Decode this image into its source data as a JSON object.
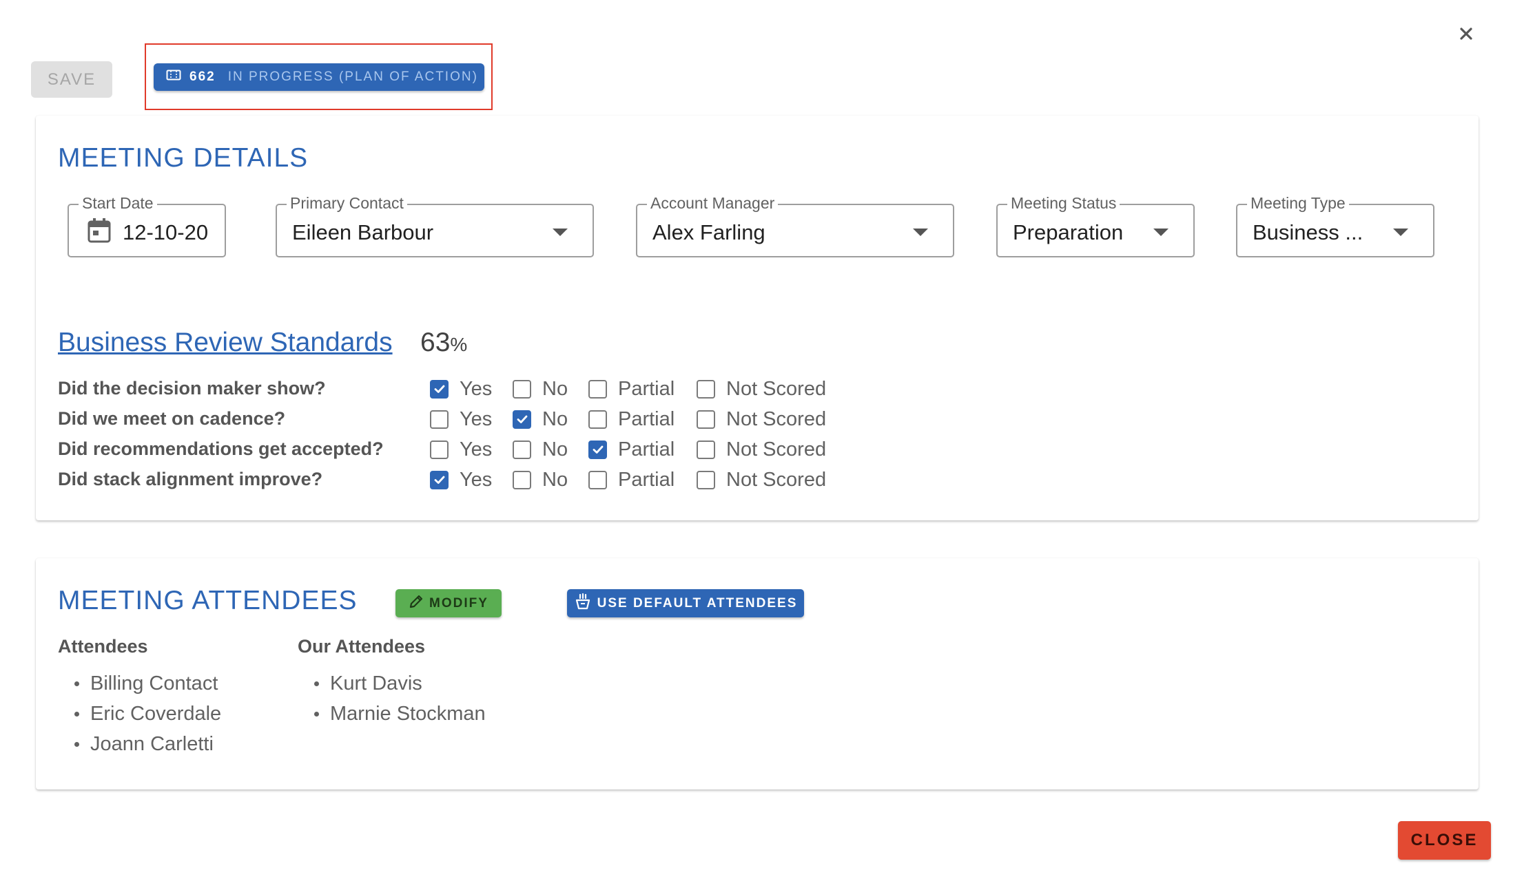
{
  "toolbar": {
    "save_label": "SAVE",
    "status_number": "662",
    "status_label": "IN PROGRESS (PLAN OF ACTION)",
    "close_icon": "close-icon"
  },
  "meeting_details": {
    "title": "MEETING DETAILS",
    "fields": {
      "start_date": {
        "label": "Start Date",
        "value": "12-10-20"
      },
      "primary_contact": {
        "label": "Primary Contact",
        "value": "Eileen Barbour"
      },
      "account_manager": {
        "label": "Account Manager",
        "value": "Alex Farling"
      },
      "meeting_status": {
        "label": "Meeting Status",
        "value": "Preparation"
      },
      "meeting_type": {
        "label": "Meeting Type",
        "value": "Business ..."
      }
    },
    "standards": {
      "title": "Business Review Standards",
      "percent": "63",
      "percent_sign": "%",
      "options": [
        "Yes",
        "No",
        "Partial",
        "Not Scored"
      ],
      "questions": [
        {
          "text": "Did the decision maker show?",
          "selected": "Yes"
        },
        {
          "text": "Did we meet on cadence?",
          "selected": "No"
        },
        {
          "text": "Did recommendations get accepted?",
          "selected": "Partial"
        },
        {
          "text": "Did stack alignment improve?",
          "selected": "Yes"
        }
      ]
    }
  },
  "attendees": {
    "title": "MEETING ATTENDEES",
    "modify_label": "MODIFY",
    "default_label": "USE DEFAULT ATTENDEES",
    "col1_title": "Attendees",
    "col1": [
      "Billing Contact",
      "Eric Coverdale",
      "Joann Carletti"
    ],
    "col2_title": "Our Attendees",
    "col2": [
      "Kurt Davis",
      "Marnie Stockman"
    ]
  },
  "footer": {
    "close_label": "CLOSE"
  },
  "colors": {
    "primary": "#2e66b5",
    "success": "#5aae52",
    "danger": "#e34a32",
    "highlight": "#e03a2a"
  }
}
